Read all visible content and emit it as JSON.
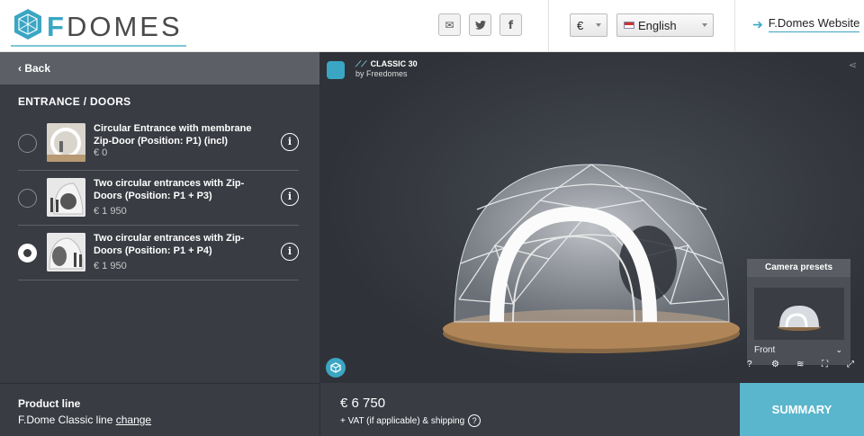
{
  "header": {
    "brand_prefix": "F",
    "brand_rest": "DOMES",
    "social": [
      {
        "icon": "email-icon",
        "glyph": "✉"
      },
      {
        "icon": "twitter-icon",
        "glyph": "🐦"
      },
      {
        "icon": "facebook-icon",
        "glyph": "f"
      }
    ],
    "currency": "€",
    "language": "English",
    "website_link": "F.Domes Website"
  },
  "left": {
    "back_label": "‹ Back",
    "section_title": "ENTRANCE / DOORS",
    "options": [
      {
        "name": "Circular Entrance with membrane Zip-Door (Position: P1) (incl)",
        "price": "€ 0",
        "selected": false,
        "info": "i"
      },
      {
        "name": "Two circular entrances with Zip-Doors (Position: P1 + P3)",
        "price": "€ 1 950",
        "selected": false,
        "info": "i"
      },
      {
        "name": "Two circular entrances with Zip-Doors (Position: P1 + P4)",
        "price": "€ 1 950",
        "selected": true,
        "info": "i"
      }
    ]
  },
  "viewer": {
    "model_title": "CLASSIC 30",
    "model_sub": "by Freedomes",
    "camera_presets_title": "Camera presets",
    "camera_preset_value": "Front",
    "tools": [
      "?",
      "⚙",
      "≋",
      "⛶",
      "⤢"
    ]
  },
  "footer": {
    "product_line_label": "Product line",
    "product_line_value": "F.Dome Classic line",
    "change_label": "change",
    "price": "€ 6 750",
    "vat_note": "+ VAT (if applicable) & shipping",
    "vat_help": "?",
    "summary_button": "SUMMARY"
  },
  "colors": {
    "accent": "#3aa6c3",
    "panel": "#393c43",
    "summary": "#5ab6cc"
  }
}
